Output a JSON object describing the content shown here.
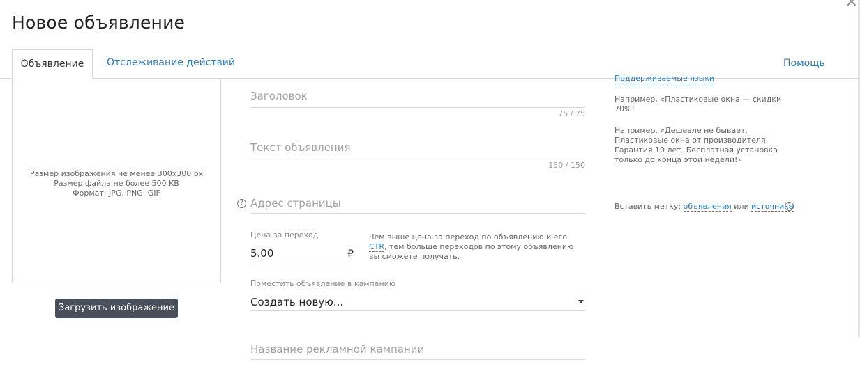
{
  "dialog": {
    "title": "Новое объявление"
  },
  "tabs": [
    {
      "label": "Объявление"
    },
    {
      "label": "Отслеживание действий"
    }
  ],
  "help_label": "Помощь",
  "image": {
    "requirements": [
      "Размер изображения не менее 300x300 px",
      "Размер файла не более 500 KB",
      "Формат: JPG, PNG, GIF"
    ],
    "upload_label": "Загрузить изображение"
  },
  "form": {
    "headline": {
      "placeholder": "Заголовок",
      "counter": "75 / 75"
    },
    "text": {
      "placeholder": "Текст объявления",
      "counter": "150 / 150"
    },
    "url": {
      "placeholder": "Адрес страницы"
    },
    "price": {
      "label": "Цена за переход",
      "value": "5.00",
      "currency": "₽",
      "hint_before": "Чем выше цена за переход по объявлению и его ",
      "hint_link": "CTR",
      "hint_after": ", тем больше переходов по этому объявлению вы сможете получать."
    },
    "campaign": {
      "label": "Поместить объявление в кампанию",
      "value": "Создать новую..."
    },
    "campaign_name": {
      "placeholder": "Название рекламной кампании"
    }
  },
  "side": {
    "languages_link": "Поддерживаемые языки",
    "headline_example": "Например, «Пластиковые окна — скидки 70%!",
    "text_example": "Например, «Дешевле не бывает. Пластиковые окна от производителя. Гарантия 10 лет. Бесплатная установка только до конца этой недели!»",
    "insert_label": "Вставить метку:",
    "insert_link1": "объявления",
    "insert_or": "или",
    "insert_link2": "источника"
  }
}
